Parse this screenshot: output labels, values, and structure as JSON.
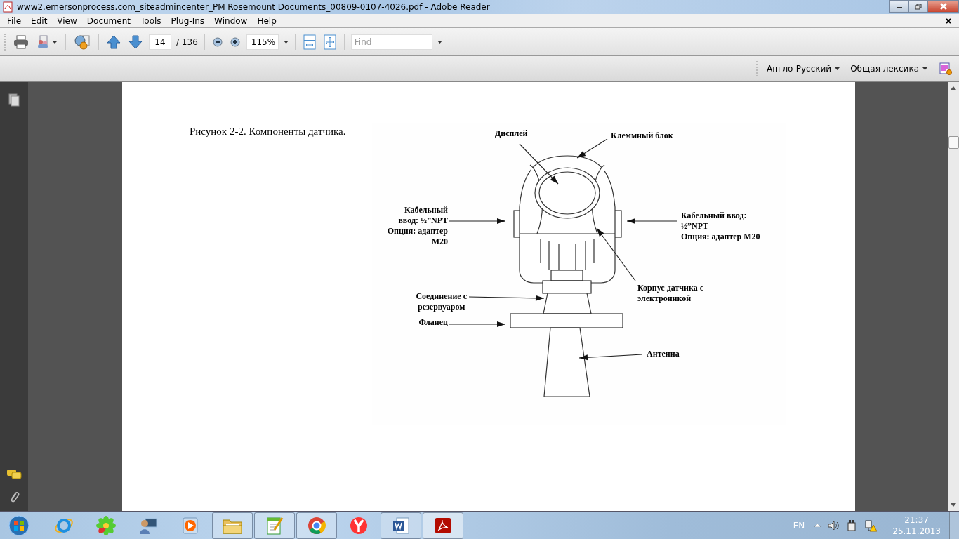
{
  "window": {
    "title": "www2.emersonprocess.com_siteadmincenter_PM Rosemount Documents_00809-0107-4026.pdf - Adobe Reader"
  },
  "menu": [
    "File",
    "Edit",
    "View",
    "Document",
    "Tools",
    "Plug-Ins",
    "Window",
    "Help"
  ],
  "toolbar": {
    "page_number": "14",
    "page_total": "/ 136",
    "zoom": "115%",
    "find": {
      "placeholder": "Find"
    }
  },
  "dictionary": {
    "direction": "Англо-Русский",
    "topic": "Общая лексика"
  },
  "document": {
    "caption": "Рисунок 2-2. Компоненты датчика.",
    "figure_labels": [
      {
        "text": "Дисплей"
      },
      {
        "text": "Клеммный блок"
      },
      {
        "text": "Кабельный\nввод: ½”NPT\nОпция: адаптер\nM20"
      },
      {
        "text": "Кабельный ввод:\n½”NPT\nОпция: адаптер M20"
      },
      {
        "text": "Корпус датчика с\nэлектроникой"
      },
      {
        "text": "Соединение с\nрезервуаром"
      },
      {
        "text": "Фланец"
      },
      {
        "text": "Антенна"
      }
    ]
  },
  "taskbar": {
    "apps": [
      {
        "kind": "ie",
        "running": false,
        "selected": false
      },
      {
        "kind": "icq",
        "running": false,
        "selected": false
      },
      {
        "kind": "admin",
        "running": false,
        "selected": false
      },
      {
        "kind": "media",
        "running": false,
        "selected": false
      },
      {
        "kind": "folder",
        "running": true,
        "selected": false
      },
      {
        "kind": "notepad",
        "running": true,
        "selected": false
      },
      {
        "kind": "chrome",
        "running": true,
        "selected": false
      },
      {
        "kind": "yandex",
        "running": false,
        "selected": false
      },
      {
        "kind": "word",
        "running": true,
        "selected": false
      },
      {
        "kind": "acrobat",
        "running": true,
        "selected": true
      }
    ],
    "language": "EN",
    "time": "21:37",
    "date": "25.11.2013"
  }
}
